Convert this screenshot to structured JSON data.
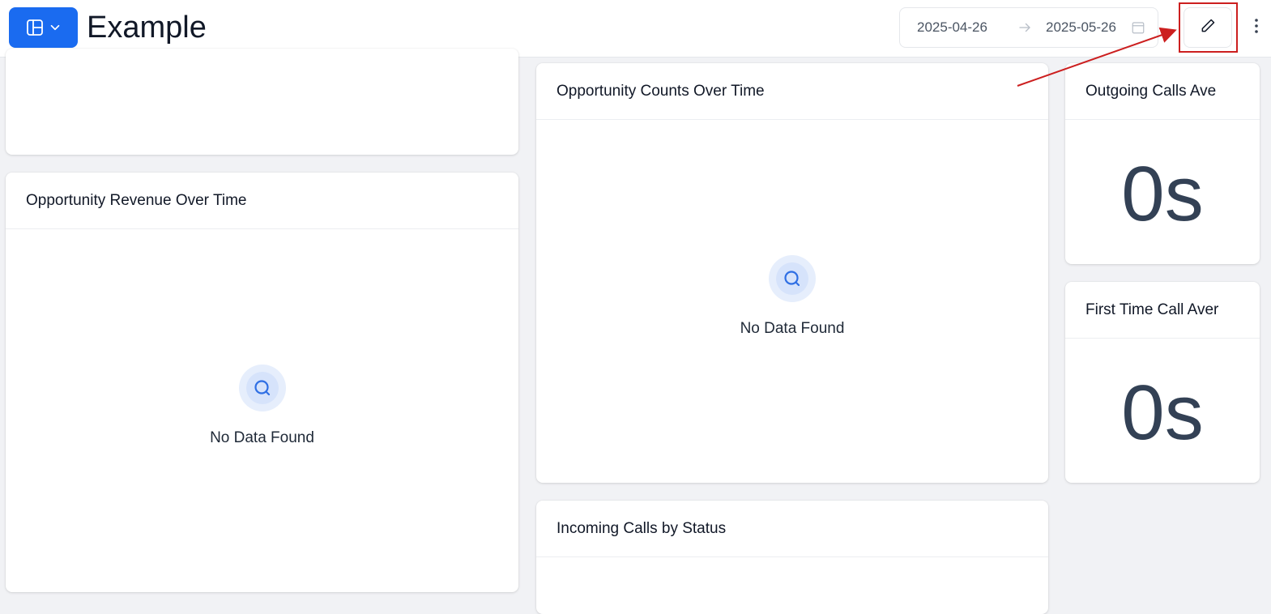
{
  "header": {
    "title": "Example",
    "date_start": "2025-04-26",
    "date_end": "2025-05-26",
    "colors": {
      "primary": "#1a6bf0",
      "highlight": "#cc1f1f"
    }
  },
  "cards": {
    "top_left": {
      "title": ""
    },
    "revenue": {
      "title": "Opportunity Revenue Over Time",
      "empty_text": "No Data Found"
    },
    "counts": {
      "title": "Opportunity Counts Over Time",
      "empty_text": "No Data Found"
    },
    "incoming": {
      "title": "Incoming Calls by Status"
    },
    "outgoing": {
      "title": "Outgoing Calls Ave",
      "value": "0s"
    },
    "first_time": {
      "title": "First Time Call Aver",
      "value": "0s"
    }
  },
  "icons": {
    "dashboard": "layout-panel-icon",
    "chevron": "chevron-down-icon",
    "arrow": "arrow-right-icon",
    "calendar": "calendar-icon",
    "edit": "pencil-icon",
    "more": "more-vertical-icon",
    "search": "search-icon"
  }
}
